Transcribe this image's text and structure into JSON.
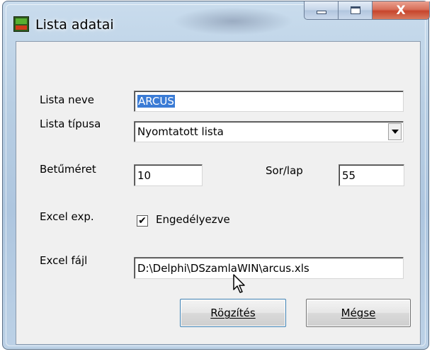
{
  "window": {
    "title": "Lista adatai",
    "close_glyph": "X"
  },
  "form": {
    "lista_neve_label": "Lista neve",
    "lista_neve_value": "ARCUS",
    "lista_tipusa_label": "Lista típusa",
    "lista_tipusa_value": "Nyomtatott lista",
    "betumeret_label": "Betűméret",
    "betumeret_value": "10",
    "sorlap_label": "Sor/lap",
    "sorlap_value": "55",
    "excel_exp_label": "Excel exp.",
    "excel_exp_checkbox_label": "Engedélyezve",
    "excel_exp_checked": true,
    "check_glyph": "✔",
    "excel_fajl_label": "Excel fájl",
    "excel_fajl_value": "D:\\Delphi\\DSzamlaWIN\\arcus.xls"
  },
  "buttons": {
    "rogzites_label": "Rögzítés",
    "megse_label": "Mégse"
  },
  "colors": {
    "selection": "#3a7bd5",
    "close_button": "#c7452c",
    "dialog_background": "#f0f0f0"
  }
}
